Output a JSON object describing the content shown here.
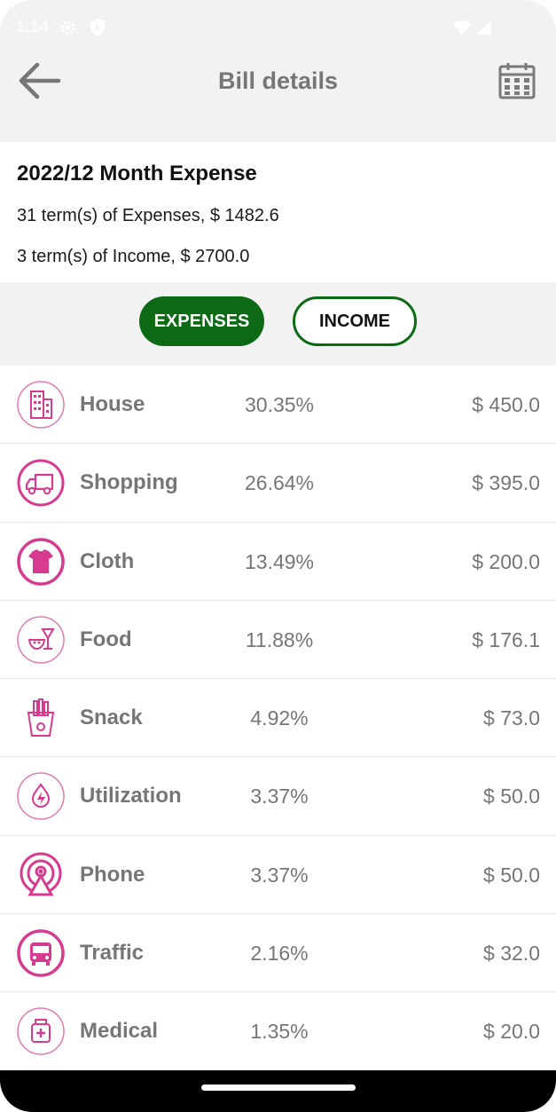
{
  "status_bar": {
    "time": "1:14"
  },
  "app_bar": {
    "title": "Bill details"
  },
  "summary": {
    "title": "2022/12 Month Expense",
    "expenses_line": "31 term(s) of Expenses, $ 1482.6",
    "income_line": "3 term(s) of Income, $ 2700.0"
  },
  "toggle": {
    "expenses_label": "EXPENSES",
    "income_label": "INCOME",
    "selected": "EXPENSES"
  },
  "colors": {
    "accent_green": "#0b6a13",
    "icon_pink": "#d63b8f",
    "text_gray": "#767676"
  },
  "categories": [
    {
      "name": "House",
      "percent": "30.35%",
      "amount": "$ 450.0",
      "icon": "house-icon"
    },
    {
      "name": "Shopping",
      "percent": "26.64%",
      "amount": "$ 395.0",
      "icon": "truck-icon"
    },
    {
      "name": "Cloth",
      "percent": "13.49%",
      "amount": "$ 200.0",
      "icon": "shirt-icon"
    },
    {
      "name": "Food",
      "percent": "11.88%",
      "amount": "$ 176.1",
      "icon": "food-icon"
    },
    {
      "name": "Snack",
      "percent": "4.92%",
      "amount": "$ 73.0",
      "icon": "fries-icon"
    },
    {
      "name": "Utilization",
      "percent": "3.37%",
      "amount": "$ 50.0",
      "icon": "lightning-icon"
    },
    {
      "name": "Phone",
      "percent": "3.37%",
      "amount": "$ 50.0",
      "icon": "antenna-icon"
    },
    {
      "name": "Traffic",
      "percent": "2.16%",
      "amount": "$ 32.0",
      "icon": "bus-icon"
    },
    {
      "name": "Medical",
      "percent": "1.35%",
      "amount": "$ 20.0",
      "icon": "medical-kit-icon"
    }
  ]
}
